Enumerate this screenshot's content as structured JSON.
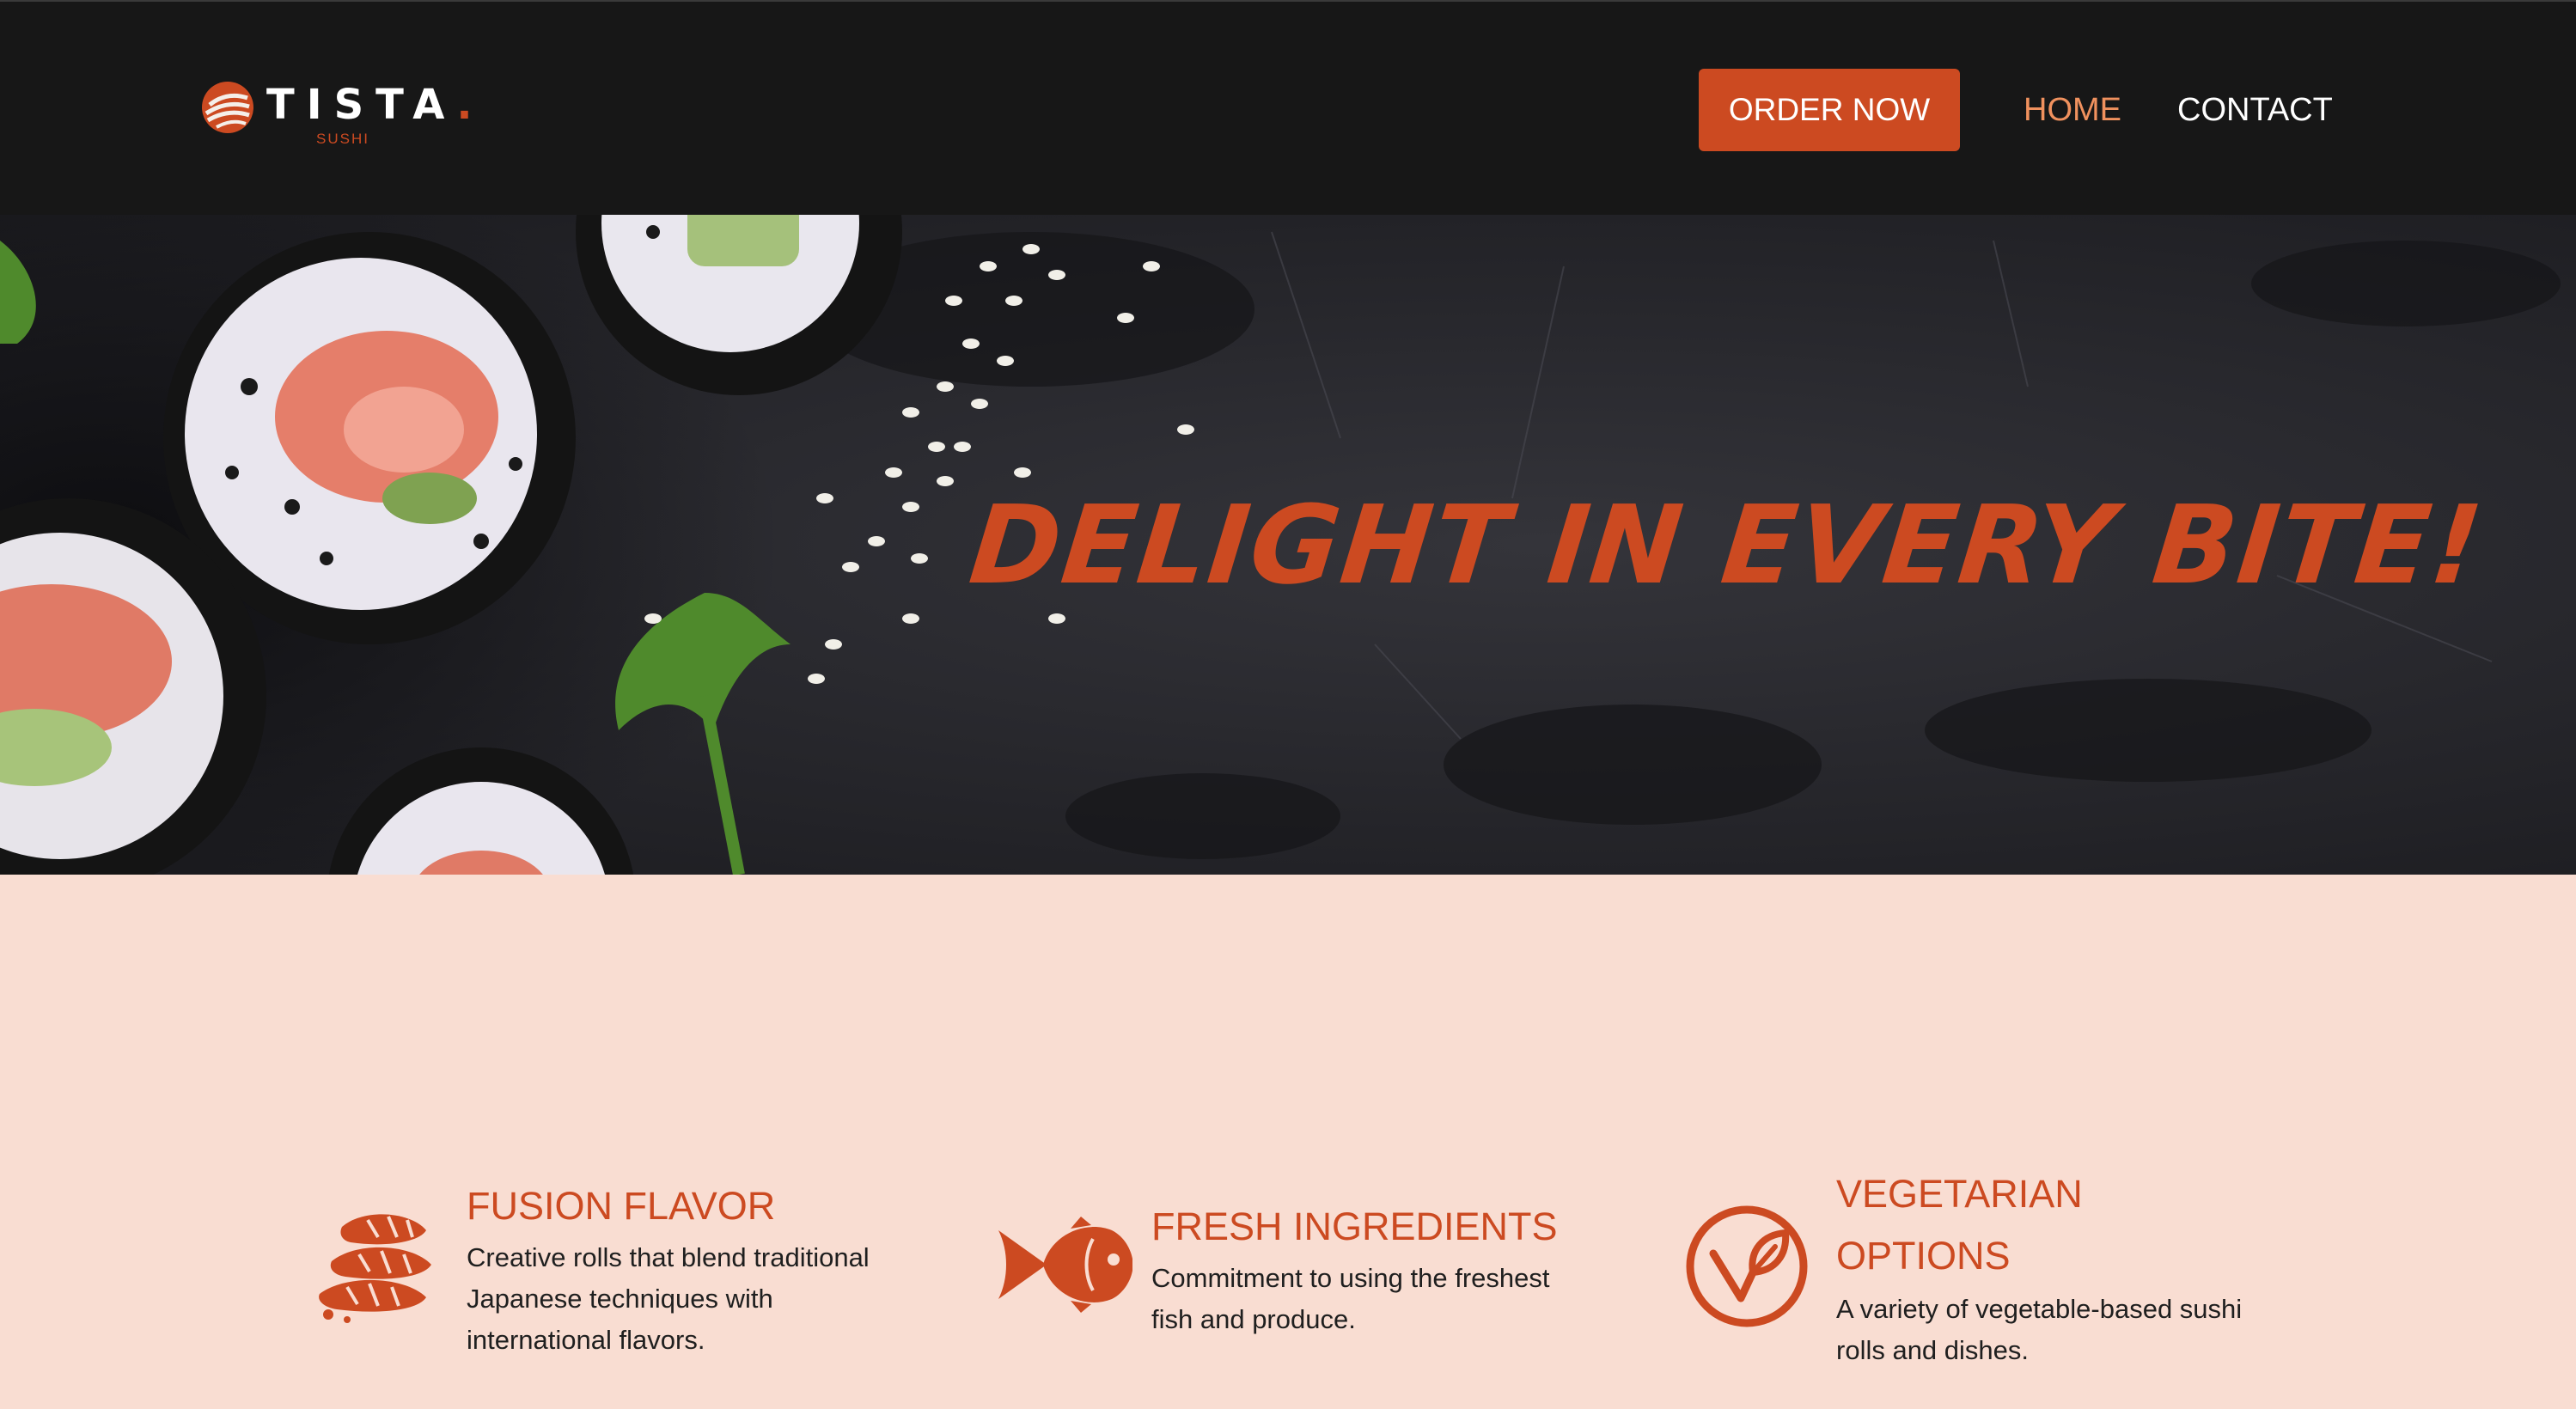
{
  "brand": {
    "name": "TISTA",
    "dot": ".",
    "tagline": "SUSHI",
    "accent_color": "#cc4a21"
  },
  "nav": {
    "order_button": "ORDER NOW",
    "links": [
      {
        "label": "HOME",
        "active": true
      },
      {
        "label": "CONTACT",
        "active": false
      }
    ]
  },
  "hero": {
    "headline": "DELIGHT IN EVERY BITE!"
  },
  "features": [
    {
      "icon": "sushi-nigiri-icon",
      "title": "FUSION FLAVOR",
      "text": "Creative rolls that blend traditional Japanese techniques with international flavors."
    },
    {
      "icon": "fish-icon",
      "title": "FRESH INGREDIENTS",
      "text": "Commitment to using the freshest fish and produce."
    },
    {
      "icon": "vegetarian-leaf-icon",
      "title": "VEGETARIAN OPTIONS",
      "text": "A variety of vegetable-based sushi rolls and dishes."
    }
  ],
  "colors": {
    "header_bg": "#171717",
    "page_bg": "#f9ddd2",
    "nav_active": "#f0915e"
  }
}
